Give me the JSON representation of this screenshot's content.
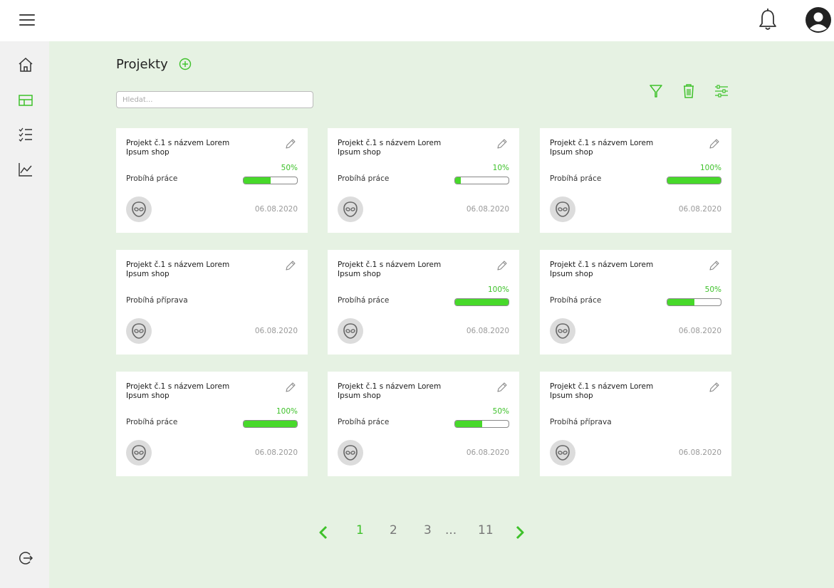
{
  "header": {
    "menu_icon": "hamburger-icon",
    "bell_icon": "bell-icon",
    "user_icon": "user-avatar-icon"
  },
  "sidebar": {
    "items": [
      {
        "icon": "home-icon"
      },
      {
        "icon": "dashboard-layout-icon",
        "active": true
      },
      {
        "icon": "checklist-icon"
      },
      {
        "icon": "chart-line-icon"
      }
    ],
    "logout_icon": "logout-icon"
  },
  "page": {
    "title": "Projekty",
    "add_icon": "plus-circle-icon",
    "search_placeholder": "Hledat...",
    "tools": [
      "filter-icon",
      "trash-icon",
      "settings-sliders-icon"
    ]
  },
  "colors": {
    "accent": "#3ec12a",
    "bar_fill": "#47d92a",
    "main_bg": "#e6f2e3",
    "sidebar_bg": "#f1f1f1"
  },
  "projects": [
    {
      "title": "Projekt č.1 s názvem Lorem Ipsum shop",
      "status": "Probíhá práce",
      "progress": 50,
      "progress_label": "50%",
      "date": "06.08.2020"
    },
    {
      "title": "Projekt č.1 s názvem Lorem Ipsum shop",
      "status": "Probíhá práce",
      "progress": 10,
      "progress_label": "10%",
      "date": "06.08.2020"
    },
    {
      "title": "Projekt č.1 s názvem Lorem Ipsum shop",
      "status": "Probíhá práce",
      "progress": 100,
      "progress_label": "100%",
      "date": "06.08.2020"
    },
    {
      "title": "Projekt č.1 s názvem Lorem Ipsum shop",
      "status": "Probíhá příprava",
      "progress": null,
      "progress_label": "",
      "date": "06.08.2020"
    },
    {
      "title": "Projekt č.1 s názvem Lorem Ipsum shop",
      "status": "Probíhá práce",
      "progress": 100,
      "progress_label": "100%",
      "date": "06.08.2020"
    },
    {
      "title": "Projekt č.1 s názvem Lorem Ipsum shop",
      "status": "Probíhá práce",
      "progress": 50,
      "progress_label": "50%",
      "date": "06.08.2020"
    },
    {
      "title": "Projekt č.1 s názvem Lorem Ipsum shop",
      "status": "Probíhá práce",
      "progress": 100,
      "progress_label": "100%",
      "date": "06.08.2020"
    },
    {
      "title": "Projekt č.1 s názvem Lorem Ipsum shop",
      "status": "Probíhá práce",
      "progress": 50,
      "progress_label": "50%",
      "date": "06.08.2020"
    },
    {
      "title": "Projekt č.1 s názvem Lorem Ipsum shop",
      "status": "Probíhá příprava",
      "progress": null,
      "progress_label": "",
      "date": "06.08.2020"
    }
  ],
  "pagination": {
    "prev_icon": "chevron-left-icon",
    "next_icon": "chevron-right-icon",
    "pages": [
      "1",
      "2",
      "3",
      "...",
      "11"
    ],
    "current": "1"
  }
}
